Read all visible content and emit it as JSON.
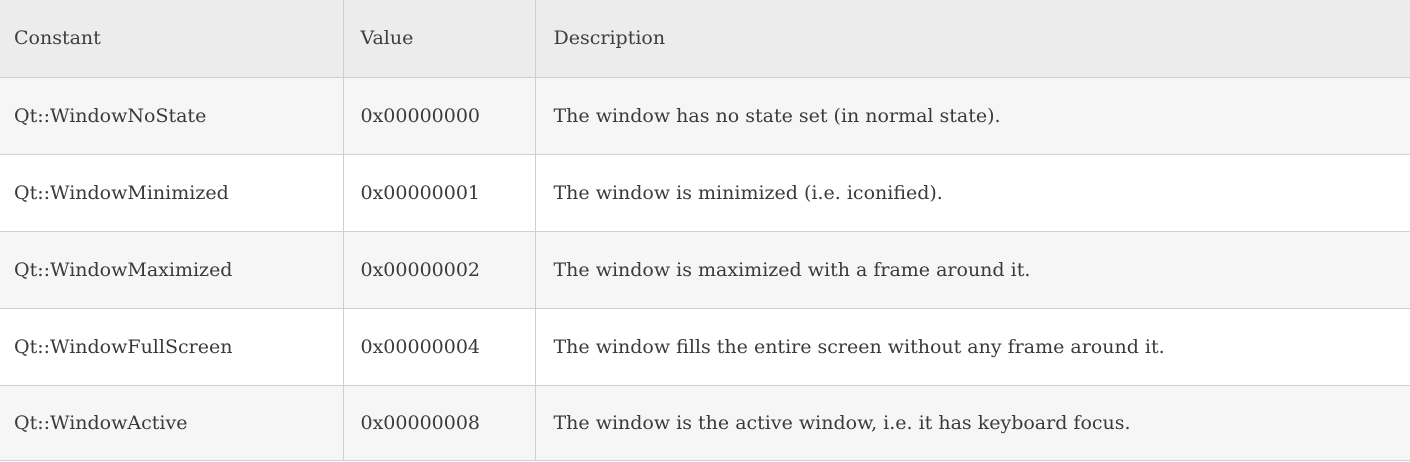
{
  "table": {
    "headers": [
      "Constant",
      "Value",
      "Description"
    ],
    "rows": [
      {
        "constant": "Qt::WindowNoState",
        "value": "0x00000000",
        "description": "The window has no state set (in normal state)."
      },
      {
        "constant": "Qt::WindowMinimized",
        "value": "0x00000001",
        "description": "The window is minimized (i.e. iconified)."
      },
      {
        "constant": "Qt::WindowMaximized",
        "value": "0x00000002",
        "description": "The window is maximized with a frame around it."
      },
      {
        "constant": "Qt::WindowFullScreen",
        "value": "0x00000004",
        "description": "The window fills the entire screen without any frame around it."
      },
      {
        "constant": "Qt::WindowActive",
        "value": "0x00000008",
        "description": "The window is the active window, i.e. it has keyboard focus."
      }
    ]
  }
}
